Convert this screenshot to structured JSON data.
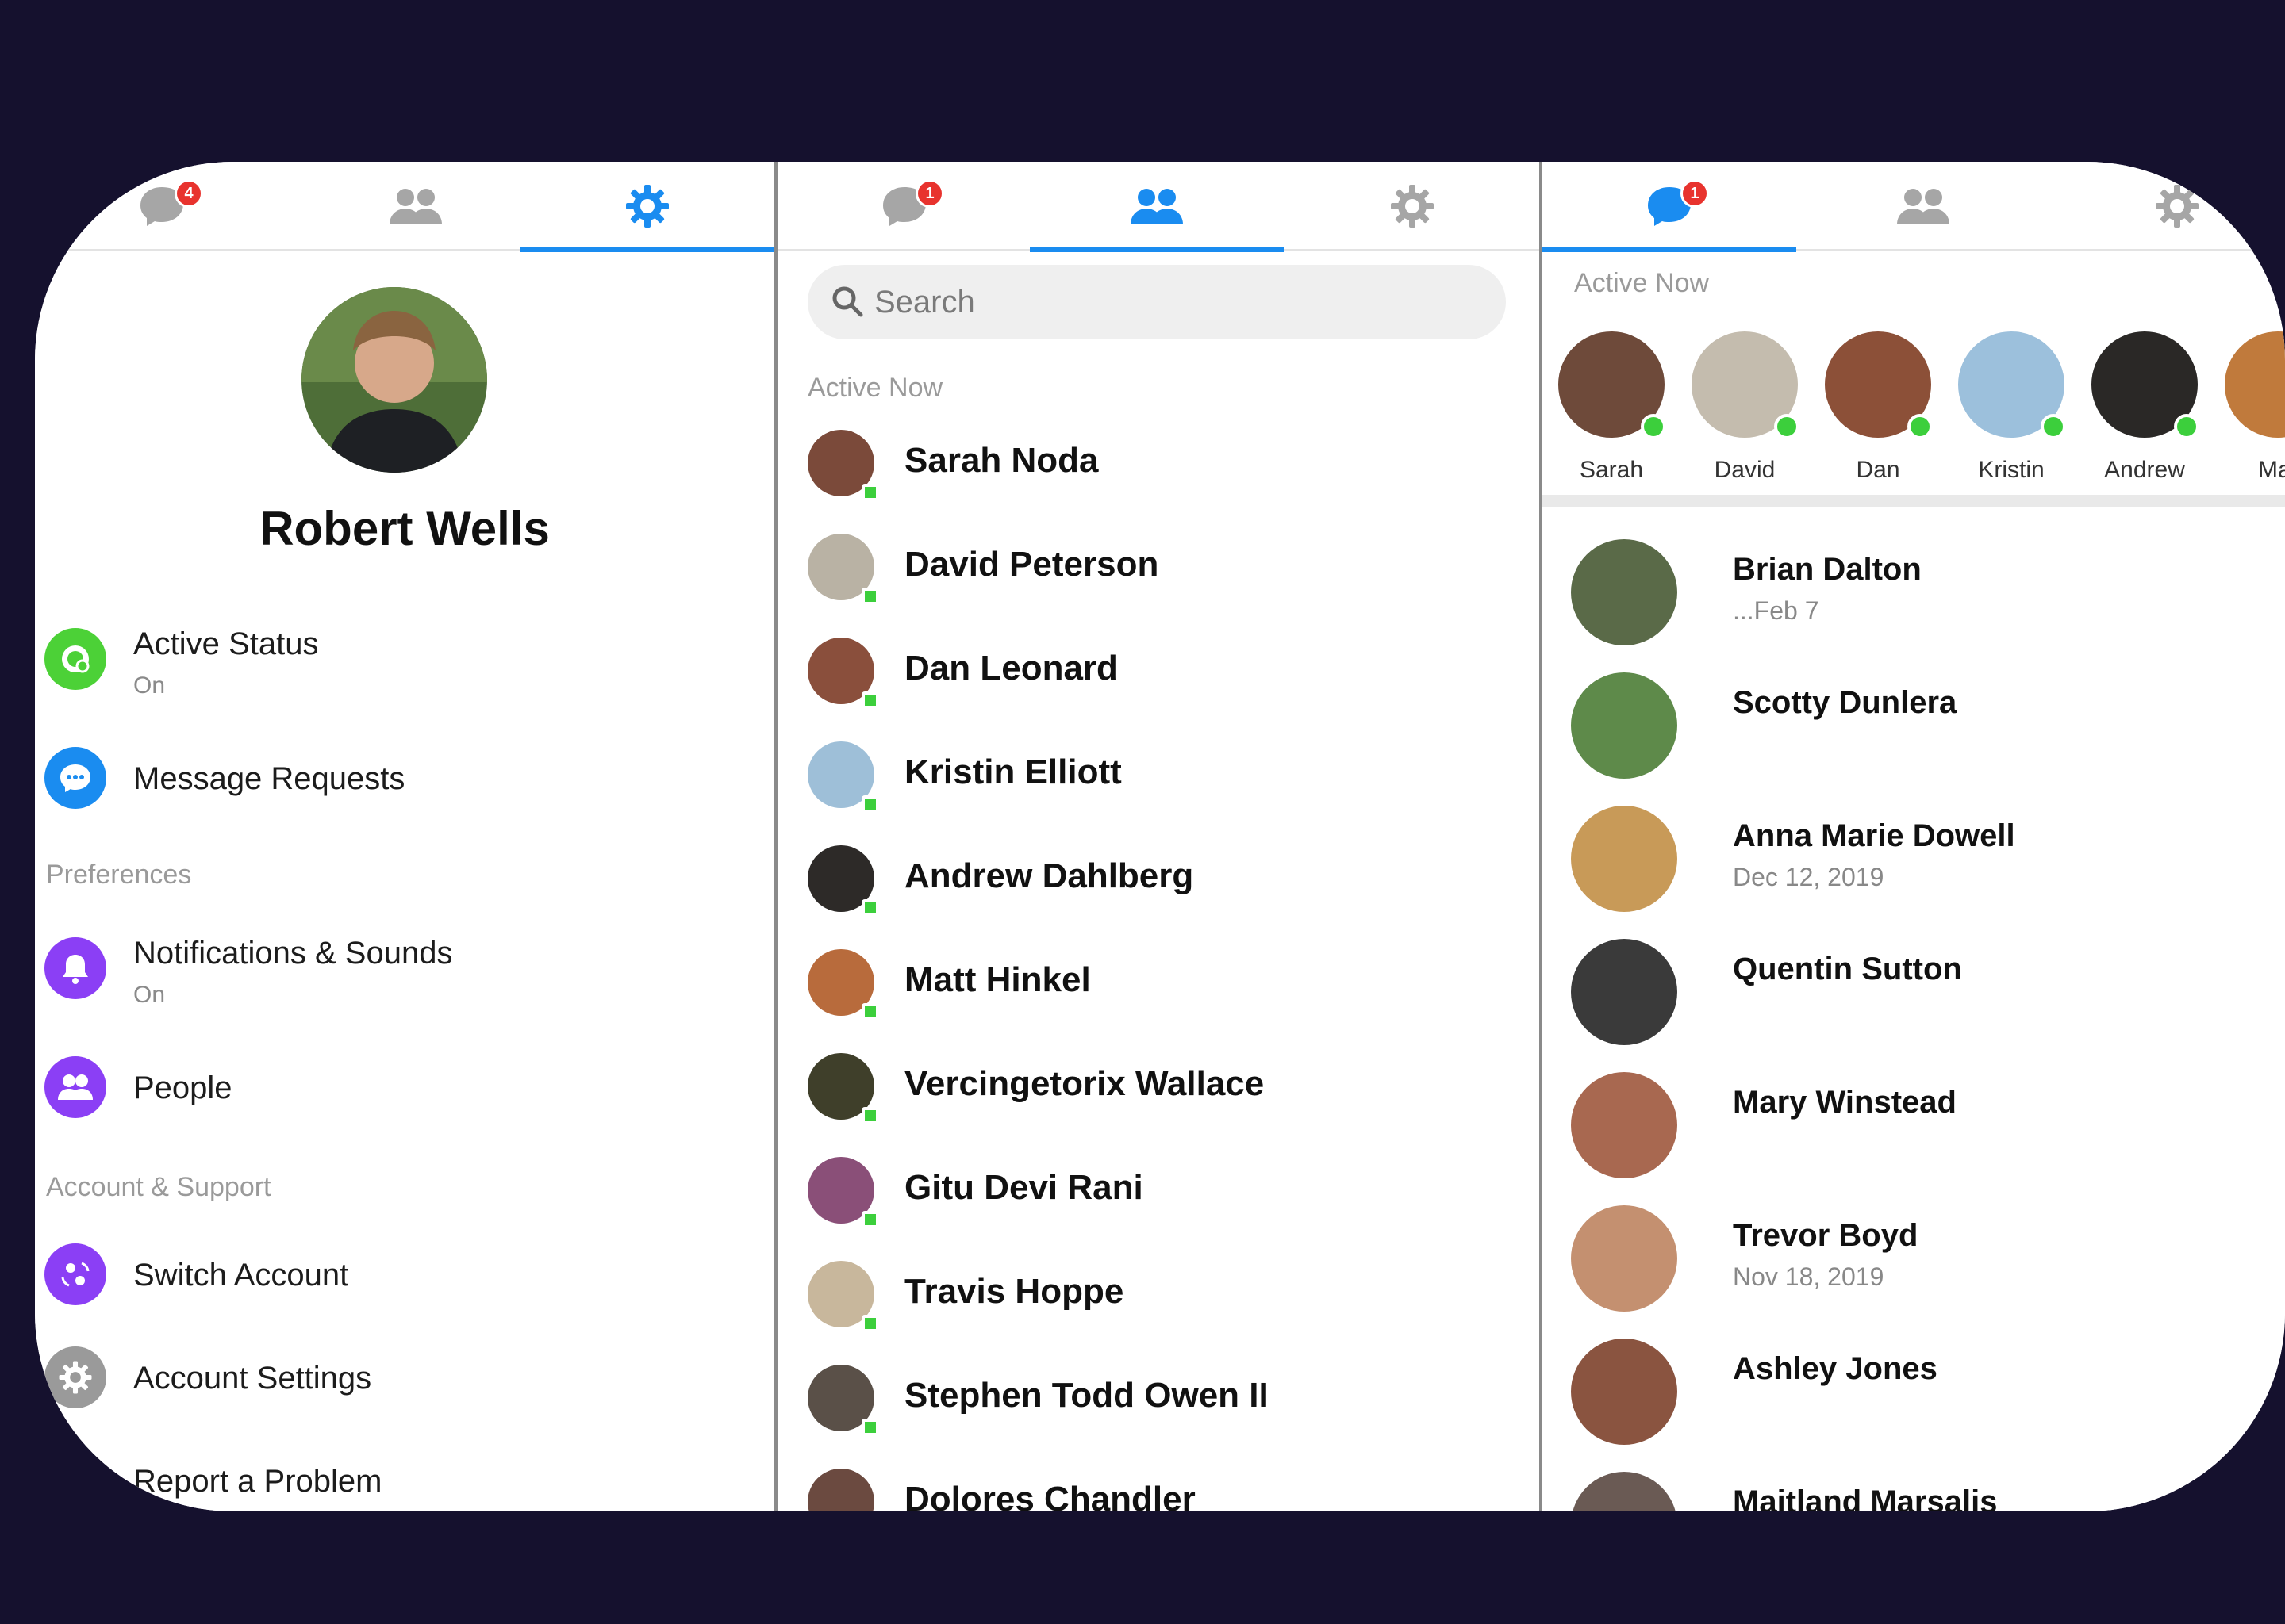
{
  "panel_settings": {
    "badge_count": "4",
    "profile_name": "Robert Wells",
    "active_status": {
      "label": "Active Status",
      "sub": "On"
    },
    "message_requests": {
      "label": "Message Requests"
    },
    "preferences_heading": "Preferences",
    "notifications": {
      "label": "Notifications & Sounds",
      "sub": "On"
    },
    "people": {
      "label": "People"
    },
    "account_heading": "Account & Support",
    "switch_account": {
      "label": "Switch Account"
    },
    "account_settings": {
      "label": "Account Settings"
    },
    "report_problem": {
      "label": "Report a Problem"
    }
  },
  "panel_people": {
    "badge_count": "1",
    "search_placeholder": "Search",
    "active_heading": "Active Now",
    "contacts": [
      {
        "name": "Sarah Noda",
        "color": "#7b4a3a"
      },
      {
        "name": "David Peterson",
        "color": "#b9b2a4"
      },
      {
        "name": "Dan Leonard",
        "color": "#8a4f3c"
      },
      {
        "name": "Kristin Elliott",
        "color": "#9ebfd8"
      },
      {
        "name": "Andrew Dahlberg",
        "color": "#2d2a28"
      },
      {
        "name": "Matt Hinkel",
        "color": "#b86b3c"
      },
      {
        "name": "Vercingetorix Wallace",
        "color": "#3f3f2a"
      },
      {
        "name": "Gitu Devi Rani",
        "color": "#8a4f78"
      },
      {
        "name": "Travis Hoppe",
        "color": "#c8b79c"
      },
      {
        "name": "Stephen Todd Owen II",
        "color": "#5a5048"
      },
      {
        "name": "Dolores Chandler",
        "color": "#6b4a40"
      }
    ]
  },
  "panel_chats": {
    "badge_count": "1",
    "active_heading": "Active Now",
    "active_now": [
      {
        "name": "Sarah",
        "color": "#6e4a3a"
      },
      {
        "name": "David",
        "color": "#c4bcae"
      },
      {
        "name": "Dan",
        "color": "#8c5038"
      },
      {
        "name": "Kristin",
        "color": "#9cc0dc"
      },
      {
        "name": "Andrew",
        "color": "#2a2826"
      },
      {
        "name": "Mat",
        "color": "#c07a3c"
      }
    ],
    "conversations": [
      {
        "name": "Brian Dalton",
        "preview": "...Feb 7",
        "color": "#5a6a48"
      },
      {
        "name": "Scotty Dunlera",
        "preview": "",
        "color": "#5e8a4a"
      },
      {
        "name": "Anna Marie Dowell",
        "preview": "Dec 12, 2019",
        "color": "#c89a58"
      },
      {
        "name": "Quentin Sutton",
        "preview": "",
        "color": "#3a3a3a"
      },
      {
        "name": "Mary Winstead",
        "preview": "",
        "color": "#a86850"
      },
      {
        "name": "Trevor Boyd",
        "preview": "Nov 18, 2019",
        "color": "#c49070"
      },
      {
        "name": "Ashley Jones",
        "preview": "",
        "color": "#8a5440"
      },
      {
        "name": "Maitland Marsalis",
        "preview": "",
        "color": "#6a5a54"
      }
    ]
  },
  "colors": {
    "accent": "#1a8cf0",
    "background": "#15112e",
    "online": "#3ccf3c",
    "badge": "#e8332e"
  }
}
